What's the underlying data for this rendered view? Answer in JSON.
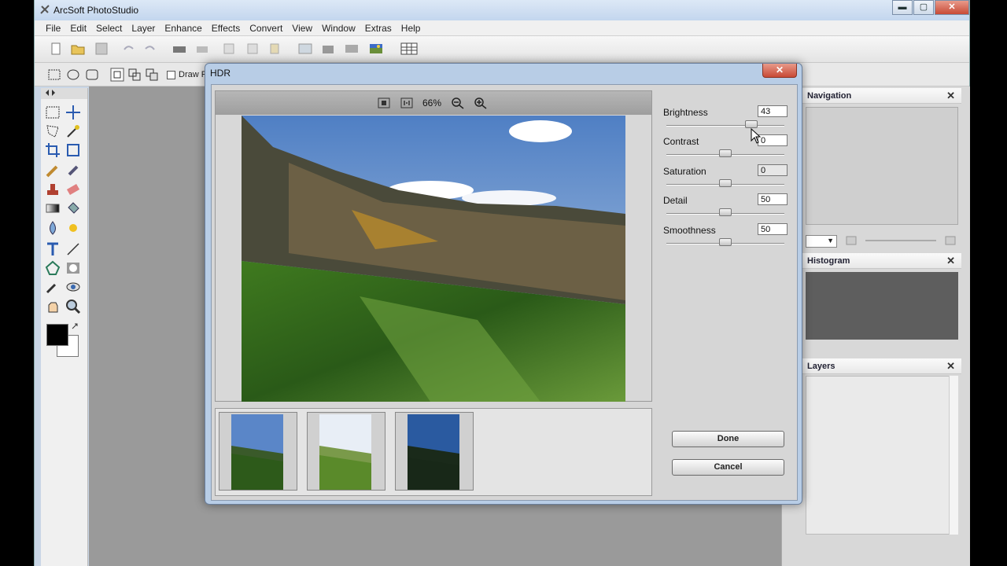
{
  "app": {
    "title": "ArcSoft PhotoStudio",
    "menu": [
      "File",
      "Edit",
      "Select",
      "Layer",
      "Enhance",
      "Effects",
      "Convert",
      "View",
      "Window",
      "Extras",
      "Help"
    ],
    "toolbar2_label": "Draw F",
    "window_buttons": {
      "minimize": "▬",
      "maximize": "▢",
      "close": "✕"
    }
  },
  "panels": {
    "navigation": {
      "title": "Navigation"
    },
    "histogram": {
      "title": "Histogram"
    },
    "layers": {
      "title": "Layers"
    },
    "close_glyph": "✕"
  },
  "dialog": {
    "title": "HDR",
    "close_glyph": "✕",
    "zoom": "66%",
    "controls": [
      {
        "label": "Brightness",
        "value": "43",
        "fraction": 0.72
      },
      {
        "label": "Contrast",
        "value": "0",
        "fraction": 0.5
      },
      {
        "label": "Saturation",
        "value": "0",
        "fraction": 0.5
      },
      {
        "label": "Detail",
        "value": "50",
        "fraction": 0.5
      },
      {
        "label": "Smoothness",
        "value": "50",
        "fraction": 0.5
      }
    ],
    "done_label": "Done",
    "cancel_label": "Cancel"
  },
  "colors": {
    "foreground": "#000000",
    "background": "#ffffff"
  }
}
